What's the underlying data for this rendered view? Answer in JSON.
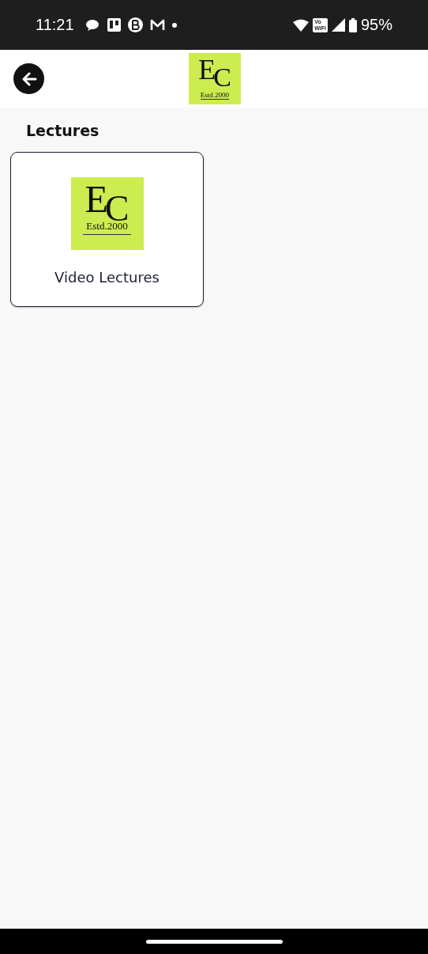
{
  "status_bar": {
    "time": "11:21",
    "wifi_badge": [
      "Vo",
      "WiFi"
    ],
    "battery": "95%"
  },
  "header": {
    "logo": {
      "letters": [
        "E",
        "C"
      ],
      "tagline": "Estd.2000"
    }
  },
  "section_title": "Lectures",
  "cards": [
    {
      "logo": {
        "letters": [
          "E",
          "C"
        ],
        "tagline": "Estd.2000"
      },
      "label": "Video Lectures"
    }
  ]
}
